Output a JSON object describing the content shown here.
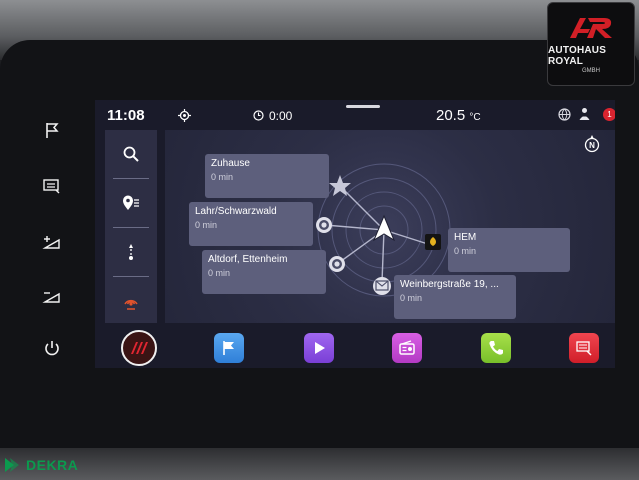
{
  "status": {
    "time": "11:08",
    "timer": "0:00",
    "temperature": "20.5",
    "temp_unit": "°C",
    "notification_count": "1"
  },
  "dealer": {
    "name": "AUTOHAUS ROYAL",
    "sub": "GMBH",
    "mark": "AR"
  },
  "watermark": {
    "text": "DEKRA"
  },
  "map": {
    "compass_label": "N",
    "destinations": [
      {
        "name": "Zuhause",
        "time": "0 min"
      },
      {
        "name": "Lahr/Schwarzwald",
        "time": "0 min"
      },
      {
        "name": "Altdorf, Ettenheim",
        "time": "0 min"
      },
      {
        "name": "HEM",
        "time": "0 min"
      },
      {
        "name": "Weinbergstraße 19, ...",
        "time": "0 min"
      }
    ]
  },
  "sidemenu": {
    "items": [
      "search-icon",
      "pin-list-icon",
      "route-icon",
      "poi-icon"
    ]
  },
  "dock": {
    "apps": [
      {
        "name": "home",
        "color": "#c8181f"
      },
      {
        "name": "navigation",
        "color": "#3b8de0"
      },
      {
        "name": "media",
        "color": "#8d4fe0"
      },
      {
        "name": "radio",
        "color": "#c447d6"
      },
      {
        "name": "phone",
        "color": "#8fd23a"
      },
      {
        "name": "car",
        "color": "#e02631"
      }
    ]
  },
  "colors": {
    "accent_red": "#c8181f",
    "screen_bg": "#1a1b2a",
    "card_bg": "#5d5f7c"
  }
}
